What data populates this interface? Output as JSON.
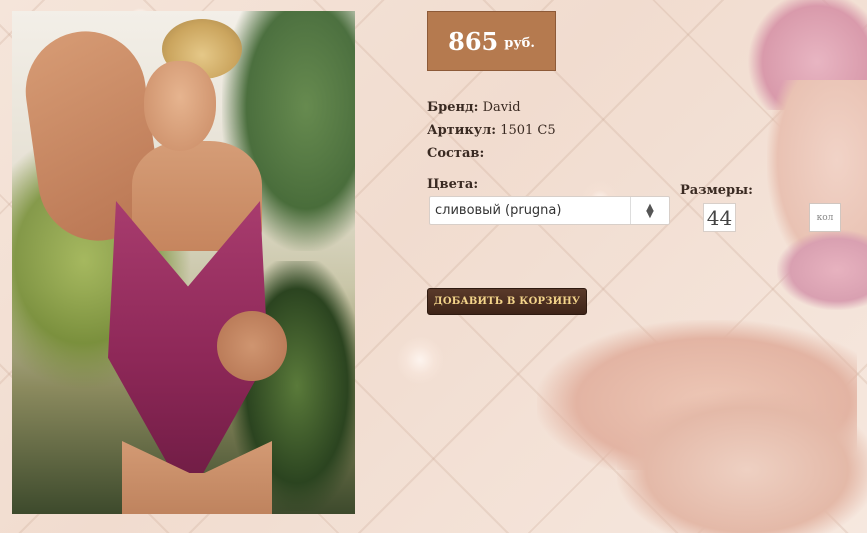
{
  "price": {
    "value": "865",
    "currency": "руб."
  },
  "product": {
    "brand_label": "Бренд:",
    "brand_value": "David",
    "article_label": "Артикул:",
    "article_value": "1501 C5",
    "composition_label": "Состав:",
    "composition_value": ""
  },
  "colors": {
    "label": "Цвета:",
    "selected": "сливовый (prugna)"
  },
  "sizes": {
    "label": "Размеры:",
    "value": "44"
  },
  "quantity": {
    "placeholder": "кол"
  },
  "cart": {
    "add_label": "ДОБАВИТЬ В КОРЗИНУ"
  },
  "theme": {
    "price_bg": "#b57a4f",
    "button_bg": "#3e2418",
    "button_text": "#f3d48a"
  }
}
